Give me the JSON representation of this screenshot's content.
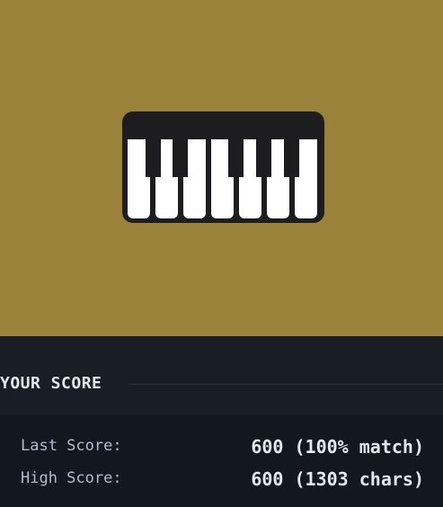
{
  "preview": {
    "icon": "piano-icon",
    "background_color": "#9a823a"
  },
  "score": {
    "title": "YOUR SCORE",
    "last_label": "Last Score:",
    "last_value": "600 (100% match)",
    "high_label": "High Score:",
    "high_value": "600 (1303 chars)"
  }
}
